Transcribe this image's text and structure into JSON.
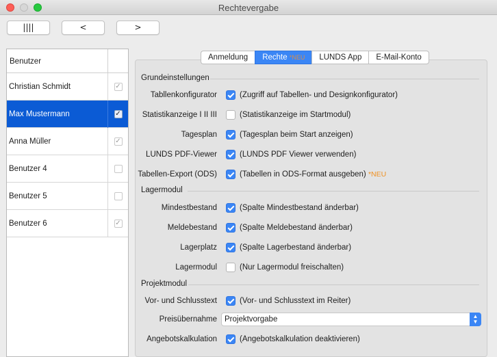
{
  "window": {
    "title": "Rechtevergabe"
  },
  "toolbar": {
    "grid_label": "||||",
    "prev_label": "<",
    "next_label": ">"
  },
  "userlist": {
    "header": "Benutzer",
    "users": [
      {
        "name": "Christian Schmidt",
        "checked": true
      },
      {
        "name": "Max Mustermann",
        "checked": true,
        "selected": true
      },
      {
        "name": "Anna Müller",
        "checked": true
      },
      {
        "name": "Benutzer 4",
        "checked": false
      },
      {
        "name": "Benutzer 5",
        "checked": false
      },
      {
        "name": "Benutzer 6",
        "checked": true
      }
    ]
  },
  "tabs": [
    {
      "label": "Anmeldung"
    },
    {
      "label": "Rechte",
      "badge": "*NEU",
      "active": true
    },
    {
      "label": "LUNDS App"
    },
    {
      "label": "E-Mail-Konto"
    }
  ],
  "sections": {
    "grund": "Grundeinstellungen",
    "lager": "Lagermodul",
    "projekt": "Projektmodul"
  },
  "settings": {
    "tabellenkonfigurator": {
      "label": "Tabllenkonfigurator",
      "checked": true,
      "desc": "(Zugriff auf Tabellen- und Designkonfigurator)"
    },
    "statistik": {
      "label": "Statistikanzeige I II III",
      "checked": false,
      "desc": "(Statistikanzeige im Startmodul)"
    },
    "tagesplan": {
      "label": "Tagesplan",
      "checked": true,
      "desc": "(Tagesplan beim Start anzeigen)"
    },
    "pdf": {
      "label": "LUNDS PDF-Viewer",
      "checked": true,
      "desc": "(LUNDS PDF Viewer verwenden)"
    },
    "export": {
      "label": "Tabellen-Export (ODS)",
      "checked": true,
      "desc": "(Tabellen in ODS-Format ausgeben)",
      "badge": "*NEU"
    },
    "mindest": {
      "label": "Mindestbestand",
      "checked": true,
      "desc": "(Spalte Mindestbestand änderbar)"
    },
    "melde": {
      "label": "Meldebestand",
      "checked": true,
      "desc": "(Spalte Meldebestand änderbar)"
    },
    "lagerplatz": {
      "label": "Lagerplatz",
      "checked": true,
      "desc": "(Spalte Lagerbestand änderbar)"
    },
    "lagermodul": {
      "label": "Lagermodul",
      "checked": false,
      "desc": "(Nur Lagermodul freischalten)"
    },
    "vorschluss": {
      "label": "Vor- und Schlusstext",
      "checked": true,
      "desc": "(Vor- und Schlusstext im Reiter)"
    },
    "preis": {
      "label": "Preisübernahme",
      "value": "Projektvorgabe"
    },
    "angebot": {
      "label": "Angebotskalkulation",
      "checked": true,
      "desc": "(Angebotskalkulation deaktivieren)"
    }
  },
  "colors": {
    "accent": "#3b86f5",
    "selection": "#0b5bd5",
    "new_badge": "#f0901f"
  }
}
